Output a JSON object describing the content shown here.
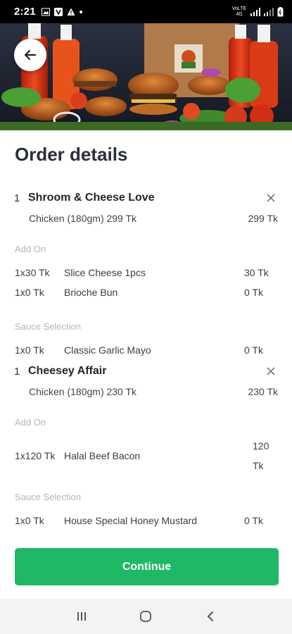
{
  "status_bar": {
    "time": "2:21",
    "network": "VoLTE 4G"
  },
  "title": "Order details",
  "items": [
    {
      "qty": "1",
      "name": "Shroom & Cheese Love",
      "variant": "Chicken (180gm) 299 Tk",
      "price": "299 Tk",
      "sections": [
        {
          "label": "Add On",
          "rows": [
            {
              "qty": "1x30 Tk",
              "name": "Slice Cheese 1pcs",
              "price": "30 Tk"
            },
            {
              "qty": "1x0 Tk",
              "name": "Brioche Bun",
              "price": "0 Tk"
            }
          ]
        },
        {
          "label": "Sauce Selection",
          "rows": [
            {
              "qty": "1x0 Tk",
              "name": "Classic Garlic Mayo",
              "price": "0 Tk"
            }
          ]
        }
      ]
    },
    {
      "qty": "1",
      "name": "Cheesey Affair",
      "variant": "Chicken (180gm) 230 Tk",
      "price": "230 Tk",
      "sections": [
        {
          "label": "Add On",
          "rows": [
            {
              "qty": "1x120 Tk",
              "name": "Halal Beef Bacon",
              "price": "120 Tk"
            }
          ]
        },
        {
          "label": "Sauce Selection",
          "rows": [
            {
              "qty": "1x0 Tk",
              "name": "House Special Honey Mustard",
              "price": "0 Tk"
            }
          ]
        }
      ]
    }
  ],
  "continue_label": "Continue",
  "colors": {
    "accent": "#1fb866",
    "muted": "#b6b6b6",
    "text": "#2a2f38"
  },
  "icons": [
    "back-arrow-icon",
    "close-icon",
    "recents-icon",
    "home-icon",
    "back-icon"
  ]
}
